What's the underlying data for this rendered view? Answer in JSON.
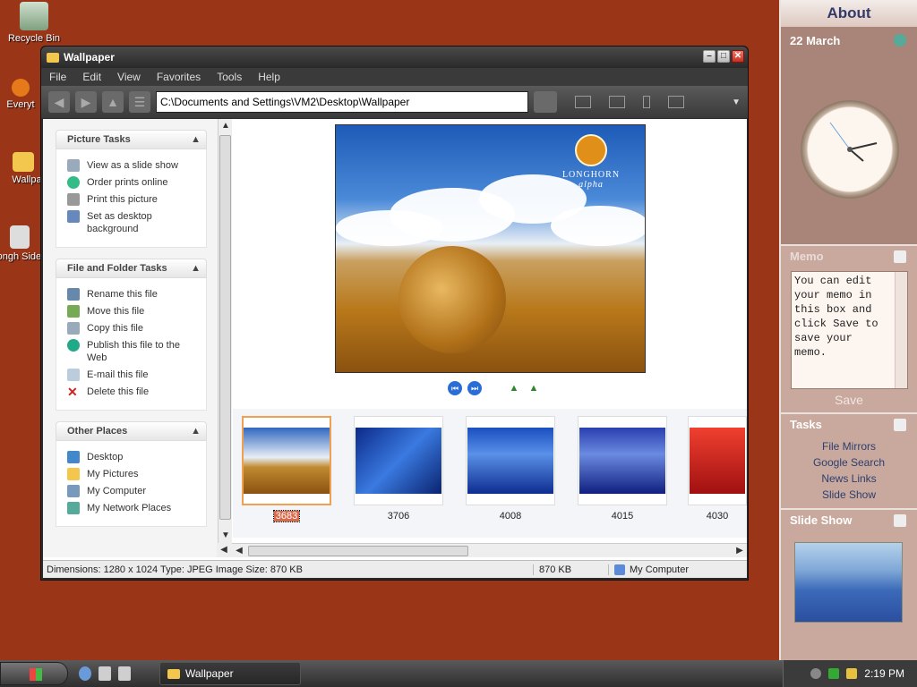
{
  "desktop": {
    "icons": [
      {
        "label": "Recycle Bin"
      },
      {
        "label": "Everyt"
      },
      {
        "label": "Wallpa"
      },
      {
        "label": "Longh SideE"
      }
    ]
  },
  "window": {
    "title": "Wallpaper",
    "menu": [
      "File",
      "Edit",
      "View",
      "Favorites",
      "Tools",
      "Help"
    ],
    "address": "C:\\Documents and Settings\\VM2\\Desktop\\Wallpaper"
  },
  "sidebar": {
    "picture_tasks": {
      "title": "Picture Tasks",
      "items": [
        "View as a slide show",
        "Order prints online",
        "Print this picture",
        "Set as desktop background"
      ]
    },
    "file_tasks": {
      "title": "File and Folder Tasks",
      "items": [
        "Rename this file",
        "Move this file",
        "Copy this file",
        "Publish this file to the Web",
        "E-mail this file",
        "Delete this file"
      ]
    },
    "other_places": {
      "title": "Other Places",
      "items": [
        "Desktop",
        "My Pictures",
        "My Computer",
        "My Network Places"
      ]
    }
  },
  "preview": {
    "logo_line1": "LONGHORN",
    "logo_line2": "alpha"
  },
  "thumbnails": [
    {
      "name": "3683",
      "selected": true
    },
    {
      "name": "3706",
      "selected": false
    },
    {
      "name": "4008",
      "selected": false
    },
    {
      "name": "4015",
      "selected": false
    },
    {
      "name": "4030",
      "selected": false
    }
  ],
  "status": {
    "details": "Dimensions: 1280 x 1024 Type: JPEG Image Size: 870 KB",
    "size": "870 KB",
    "zone": "My Computer"
  },
  "gadgets": {
    "about": "About",
    "date": "22 March",
    "memo_title": "Memo",
    "memo_text": "You can edit your memo in this box and click Save to save your memo.",
    "save": "Save",
    "tasks_title": "Tasks",
    "tasks": [
      "File Mirrors",
      "Google Search",
      "News Links",
      "Slide Show"
    ],
    "slideshow_title": "Slide Show"
  },
  "taskbar": {
    "window_button": "Wallpaper",
    "time": "2:19 PM"
  }
}
